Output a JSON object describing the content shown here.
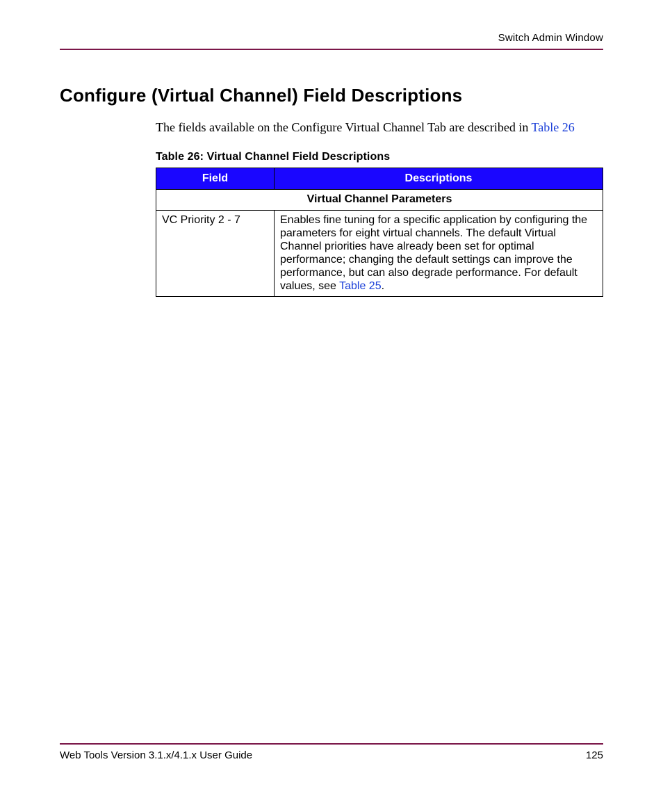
{
  "header": {
    "running_head": "Switch Admin Window"
  },
  "heading": "Configure (Virtual Channel) Field Descriptions",
  "intro": {
    "text": "The fields available on the Configure Virtual Channel Tab are described in ",
    "link": "Table 26"
  },
  "table": {
    "caption": "Table 26:  Virtual Channel Field Descriptions",
    "columns": {
      "field": "Field",
      "descriptions": "Descriptions"
    },
    "subheader": "Virtual Channel Parameters",
    "row": {
      "field": "VC Priority 2 - 7",
      "desc_pre": "Enables fine tuning for a specific application by configuring the parameters for eight virtual channels. The default Virtual Channel priorities have already been set for optimal performance; changing the default settings can improve the performance, but can also degrade performance. For default values, see ",
      "desc_link": "Table 25",
      "desc_post": "."
    }
  },
  "footer": {
    "left": "Web Tools Version 3.1.x/4.1.x User Guide",
    "right": "125"
  }
}
